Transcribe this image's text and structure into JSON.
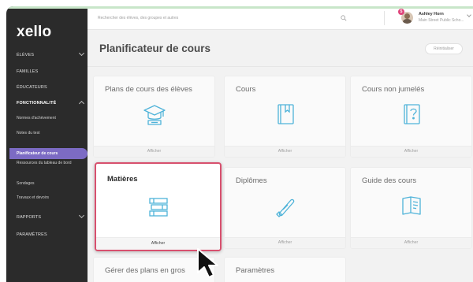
{
  "brand": {
    "logo_text": "xello"
  },
  "sidebar": {
    "sections": [
      {
        "label": "ÉLÈVES",
        "has_chevron": true
      },
      {
        "label": "FAMILLES"
      },
      {
        "label": "ÉDUCATEURS"
      },
      {
        "label": "FONCTIONNALITÉ",
        "has_chevron": true,
        "expanded": true
      },
      {
        "label": "RAPPORTS",
        "has_chevron": true
      },
      {
        "label": "PARAMÈTRES"
      }
    ],
    "sub_items": [
      {
        "label": "Normes d'achèvement"
      },
      {
        "label": "Notes du test"
      },
      {
        "label": "Planificateur de cours",
        "active": true
      },
      {
        "label": "Ressources du tableau de bord"
      },
      {
        "label": "Sondages"
      },
      {
        "label": "Travaux et devoirs"
      }
    ]
  },
  "topbar": {
    "search_placeholder": "Rechercher des élèves, des groupes et autres",
    "user": {
      "name": "Ashley Horn",
      "school": "Main Street Public Scho...",
      "badge": "5"
    }
  },
  "main": {
    "title": "Planificateur de cours",
    "reset_label": "Réinitialiser",
    "cards": [
      {
        "title": "Plans de cours des élèves",
        "footer": "Afficher",
        "icon": "graduation-cap-icon"
      },
      {
        "title": "Cours",
        "footer": "Afficher",
        "icon": "book-icon"
      },
      {
        "title": "Cours non jumelés",
        "footer": "Afficher",
        "icon": "question-book-icon"
      },
      {
        "title": "Matières",
        "footer": "Afficher",
        "icon": "stacked-books-icon",
        "selected": true
      },
      {
        "title": "Diplômes",
        "footer": "Afficher",
        "icon": "diploma-scroll-icon"
      },
      {
        "title": "Guide des cours",
        "footer": "Afficher",
        "icon": "course-guide-icon"
      },
      {
        "title": "Gérer des plans en gros",
        "icon": "bulk-plans-icon"
      },
      {
        "title": "Paramètres",
        "icon": "settings-icon"
      }
    ]
  },
  "colors": {
    "sidebar_bg": "#2b2b2b",
    "active_item": "#7c6bc4",
    "icon_blue": "#4fb3d9",
    "selected_border": "#d8506e"
  }
}
